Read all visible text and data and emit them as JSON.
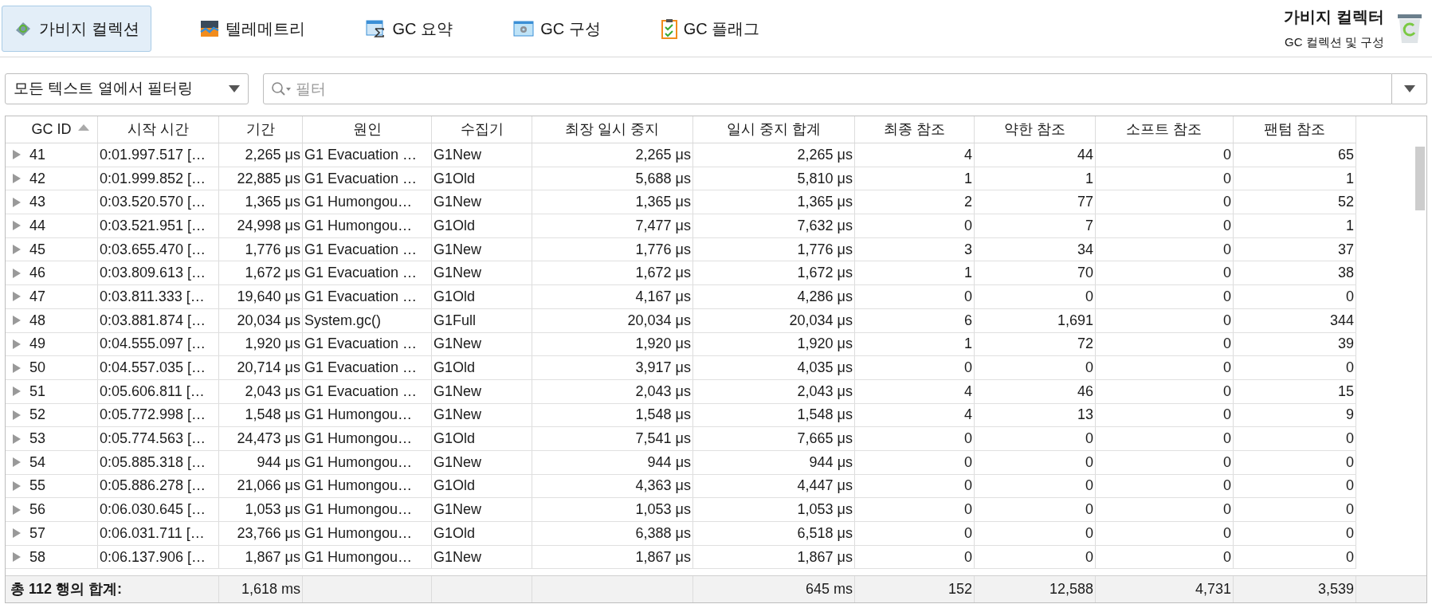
{
  "toolbar": {
    "tabs": [
      {
        "label": "가비지 컬렉션",
        "selected": true
      },
      {
        "label": "텔레메트리",
        "selected": false
      },
      {
        "label": "GC 요약",
        "selected": false
      },
      {
        "label": "GC 구성",
        "selected": false
      },
      {
        "label": "GC 플래그",
        "selected": false
      }
    ],
    "title": "가비지 컬렉터",
    "subtitle": "GC 컬렉션 및 구성"
  },
  "filter": {
    "scope": "모든 텍스트 열에서 필터링",
    "placeholder": "필터"
  },
  "table": {
    "columns": [
      {
        "label": "GC ID",
        "sorted": true
      },
      {
        "label": "시작 시간",
        "sorted": false
      },
      {
        "label": "기간",
        "sorted": false,
        "total": "1,618 ms"
      },
      {
        "label": "원인",
        "sorted": false
      },
      {
        "label": "수집기",
        "sorted": false
      },
      {
        "label": "최장 일시 중지",
        "sorted": false
      },
      {
        "label": "일시 중지 합계",
        "sorted": false,
        "total": "645 ms"
      },
      {
        "label": "최종 참조",
        "sorted": false,
        "total": "152"
      },
      {
        "label": "약한 참조",
        "sorted": false,
        "total": "12,588"
      },
      {
        "label": "소프트 참조",
        "sorted": false,
        "total": "4,731"
      },
      {
        "label": "팬텀 참조",
        "sorted": false,
        "total": "3,539"
      }
    ],
    "rows": [
      {
        "expanded": false,
        "id": "41",
        "start": "0:01.997.517 […",
        "duration": "2,265 μs",
        "cause": "G1 Evacuation …",
        "collector": "G1New",
        "longest": "2,265 μs",
        "total": "2,265 μs",
        "final": "4",
        "weak": "44",
        "soft": "0",
        "phantom": "65"
      },
      {
        "expanded": false,
        "id": "42",
        "start": "0:01.999.852 […",
        "duration": "22,885 μs",
        "cause": "G1 Evacuation …",
        "collector": "G1Old",
        "longest": "5,688 μs",
        "total": "5,810 μs",
        "final": "1",
        "weak": "1",
        "soft": "0",
        "phantom": "1"
      },
      {
        "expanded": false,
        "id": "43",
        "start": "0:03.520.570 […",
        "duration": "1,365 μs",
        "cause": "G1 Humongou…",
        "collector": "G1New",
        "longest": "1,365 μs",
        "total": "1,365 μs",
        "final": "2",
        "weak": "77",
        "soft": "0",
        "phantom": "52"
      },
      {
        "expanded": false,
        "id": "44",
        "start": "0:03.521.951 […",
        "duration": "24,998 μs",
        "cause": "G1 Humongou…",
        "collector": "G1Old",
        "longest": "7,477 μs",
        "total": "7,632 μs",
        "final": "0",
        "weak": "7",
        "soft": "0",
        "phantom": "1"
      },
      {
        "expanded": false,
        "id": "45",
        "start": "0:03.655.470 […",
        "duration": "1,776 μs",
        "cause": "G1 Evacuation …",
        "collector": "G1New",
        "longest": "1,776 μs",
        "total": "1,776 μs",
        "final": "3",
        "weak": "34",
        "soft": "0",
        "phantom": "37"
      },
      {
        "expanded": false,
        "id": "46",
        "start": "0:03.809.613 […",
        "duration": "1,672 μs",
        "cause": "G1 Evacuation …",
        "collector": "G1New",
        "longest": "1,672 μs",
        "total": "1,672 μs",
        "final": "1",
        "weak": "70",
        "soft": "0",
        "phantom": "38"
      },
      {
        "expanded": false,
        "id": "47",
        "start": "0:03.811.333 […",
        "duration": "19,640 μs",
        "cause": "G1 Evacuation …",
        "collector": "G1Old",
        "longest": "4,167 μs",
        "total": "4,286 μs",
        "final": "0",
        "weak": "0",
        "soft": "0",
        "phantom": "0"
      },
      {
        "expanded": false,
        "id": "48",
        "start": "0:03.881.874 […",
        "duration": "20,034 μs",
        "cause": "System.gc()",
        "collector": "G1Full",
        "longest": "20,034 μs",
        "total": "20,034 μs",
        "final": "6",
        "weak": "1,691",
        "soft": "0",
        "phantom": "344"
      },
      {
        "expanded": false,
        "id": "49",
        "start": "0:04.555.097 […",
        "duration": "1,920 μs",
        "cause": "G1 Evacuation …",
        "collector": "G1New",
        "longest": "1,920 μs",
        "total": "1,920 μs",
        "final": "1",
        "weak": "72",
        "soft": "0",
        "phantom": "39"
      },
      {
        "expanded": false,
        "id": "50",
        "start": "0:04.557.035 […",
        "duration": "20,714 μs",
        "cause": "G1 Evacuation …",
        "collector": "G1Old",
        "longest": "3,917 μs",
        "total": "4,035 μs",
        "final": "0",
        "weak": "0",
        "soft": "0",
        "phantom": "0"
      },
      {
        "expanded": false,
        "id": "51",
        "start": "0:05.606.811 […",
        "duration": "2,043 μs",
        "cause": "G1 Evacuation …",
        "collector": "G1New",
        "longest": "2,043 μs",
        "total": "2,043 μs",
        "final": "4",
        "weak": "46",
        "soft": "0",
        "phantom": "15"
      },
      {
        "expanded": false,
        "id": "52",
        "start": "0:05.772.998 […",
        "duration": "1,548 μs",
        "cause": "G1 Humongou…",
        "collector": "G1New",
        "longest": "1,548 μs",
        "total": "1,548 μs",
        "final": "4",
        "weak": "13",
        "soft": "0",
        "phantom": "9"
      },
      {
        "expanded": false,
        "id": "53",
        "start": "0:05.774.563 […",
        "duration": "24,473 μs",
        "cause": "G1 Humongou…",
        "collector": "G1Old",
        "longest": "7,541 μs",
        "total": "7,665 μs",
        "final": "0",
        "weak": "0",
        "soft": "0",
        "phantom": "0"
      },
      {
        "expanded": false,
        "id": "54",
        "start": "0:05.885.318 […",
        "duration": "944 μs",
        "cause": "G1 Humongou…",
        "collector": "G1New",
        "longest": "944 μs",
        "total": "944 μs",
        "final": "0",
        "weak": "0",
        "soft": "0",
        "phantom": "0"
      },
      {
        "expanded": false,
        "id": "55",
        "start": "0:05.886.278 […",
        "duration": "21,066 μs",
        "cause": "G1 Humongou…",
        "collector": "G1Old",
        "longest": "4,363 μs",
        "total": "4,447 μs",
        "final": "0",
        "weak": "0",
        "soft": "0",
        "phantom": "0"
      },
      {
        "expanded": false,
        "id": "56",
        "start": "0:06.030.645 […",
        "duration": "1,053 μs",
        "cause": "G1 Humongou…",
        "collector": "G1New",
        "longest": "1,053 μs",
        "total": "1,053 μs",
        "final": "0",
        "weak": "0",
        "soft": "0",
        "phantom": "0"
      },
      {
        "expanded": false,
        "id": "57",
        "start": "0:06.031.711 […",
        "duration": "23,766 μs",
        "cause": "G1 Humongou…",
        "collector": "G1Old",
        "longest": "6,388 μs",
        "total": "6,518 μs",
        "final": "0",
        "weak": "0",
        "soft": "0",
        "phantom": "0"
      },
      {
        "expanded": false,
        "id": "58",
        "start": "0:06.137.906 […",
        "duration": "1,867 μs",
        "cause": "G1 Humongou…",
        "collector": "G1New",
        "longest": "1,867 μs",
        "total": "1,867 μs",
        "final": "0",
        "weak": "0",
        "soft": "0",
        "phantom": "0"
      }
    ],
    "totals_label": "총 112 행의 합계:"
  }
}
